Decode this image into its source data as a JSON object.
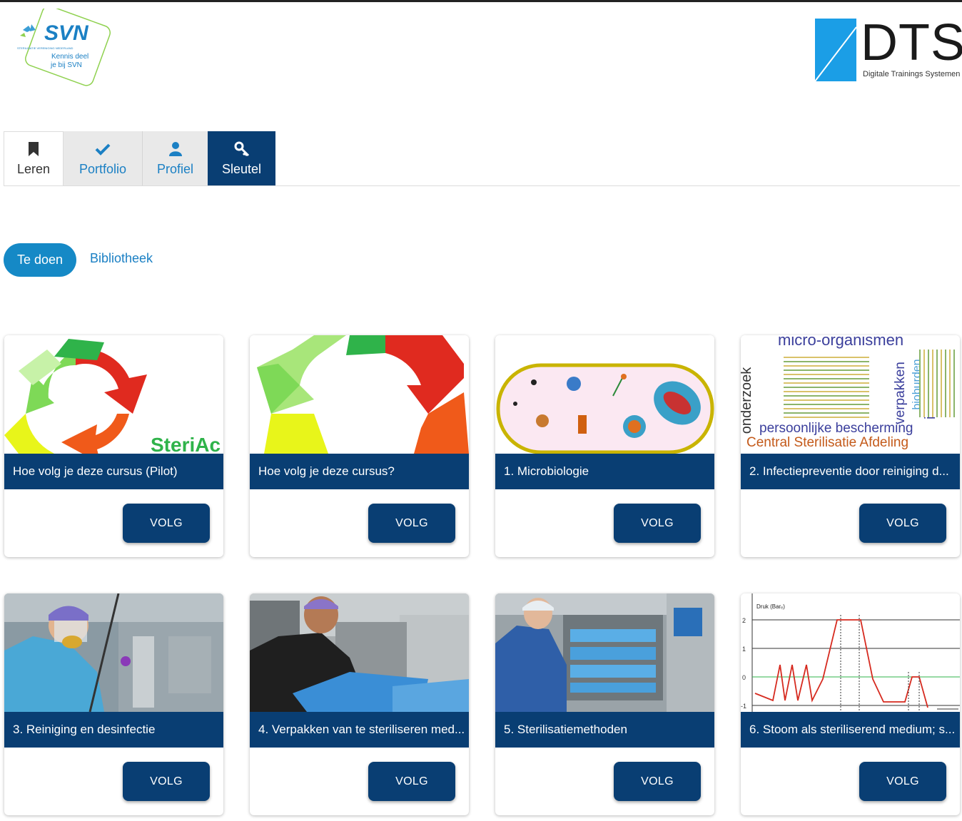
{
  "header": {
    "svn_logo": {
      "brand": "SVN",
      "tagline_small": "STERILISATIE VERENIGING NEDERLAND",
      "slogan_line1": "Kennis deel",
      "slogan_line2": "je bij SVN"
    },
    "dts_logo": {
      "brand": "DTS",
      "subtitle": "Digitale Trainings Systemen"
    }
  },
  "tabs": [
    {
      "label": "Leren",
      "icon": "bookmark-icon",
      "active": true
    },
    {
      "label": "Portfolio",
      "icon": "checkmark-icon"
    },
    {
      "label": "Profiel",
      "icon": "user-icon"
    },
    {
      "label": "Sleutel",
      "icon": "key-icon"
    }
  ],
  "subnav": {
    "active": "Te doen",
    "other": "Bibliotheek"
  },
  "courses": [
    {
      "title": "Hoe volg je deze cursus (Pilot)",
      "button": "VOLG",
      "image_text": "SteriAc"
    },
    {
      "title": "Hoe volg je deze cursus?",
      "button": "VOLG"
    },
    {
      "title": "1. Microbiologie",
      "button": "VOLG"
    },
    {
      "title": "2. Infectiepreventie door reiniging d...",
      "button": "VOLG",
      "image_words": [
        "micro-organismen",
        "onderzoek",
        "verpakken",
        "persoonlijke bescherming",
        "Central Sterilisatie Afdeling",
        "inactivatie",
        "bioburden"
      ]
    },
    {
      "title": "3. Reiniging en desinfectie",
      "button": "VOLG"
    },
    {
      "title": "4. Verpakken van te steriliseren med...",
      "button": "VOLG"
    },
    {
      "title": "5. Sterilisatiemethoden",
      "button": "VOLG"
    },
    {
      "title": "6. Stoom als steriliserend medium; s...",
      "button": "VOLG",
      "image_text": "Druk (Barₑ)"
    }
  ],
  "colors": {
    "navy": "#093e73",
    "blue": "#1589c6",
    "link": "#1b80c4"
  }
}
